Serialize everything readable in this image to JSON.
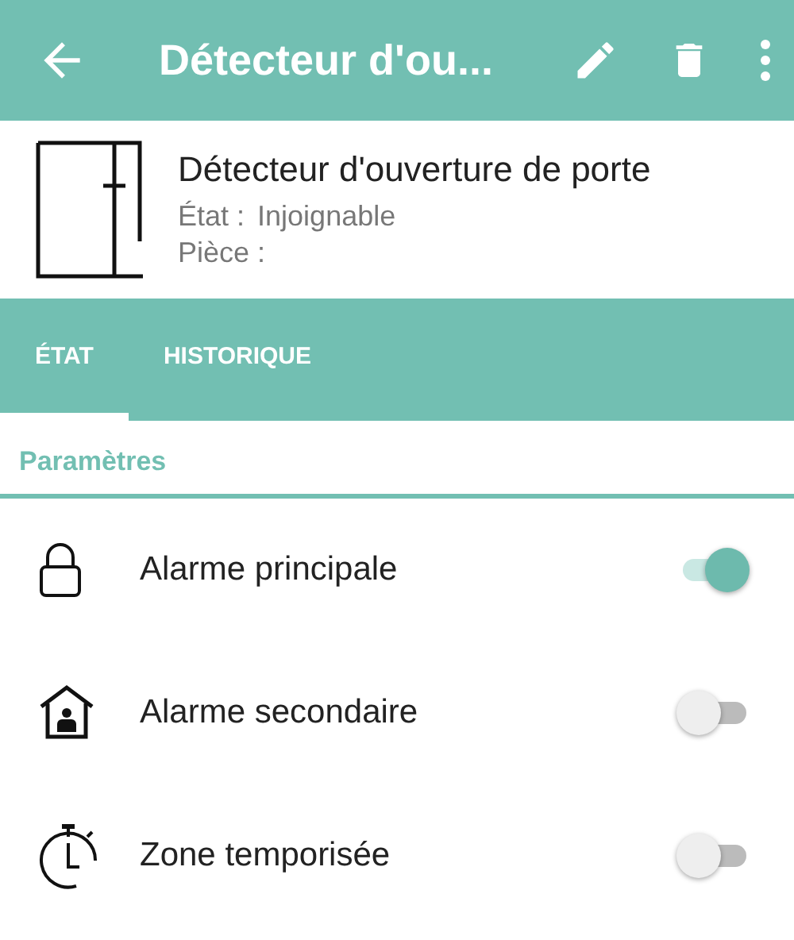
{
  "app_bar": {
    "title": "Détecteur d'ou..."
  },
  "device": {
    "name": "Détecteur d'ouverture de porte",
    "state_label": "État :",
    "state_value": "Injoignable",
    "room_label": "Pièce :"
  },
  "tabs": [
    {
      "label": "ÉTAT",
      "selected": true
    },
    {
      "label": "HISTORIQUE",
      "selected": false
    }
  ],
  "section": {
    "title": "Paramètres"
  },
  "settings": [
    {
      "kind": "lock",
      "label": "Alarme principale",
      "on": true
    },
    {
      "kind": "house",
      "label": "Alarme secondaire",
      "on": false
    },
    {
      "kind": "timer",
      "label": "Zone temporisée",
      "on": false
    }
  ]
}
